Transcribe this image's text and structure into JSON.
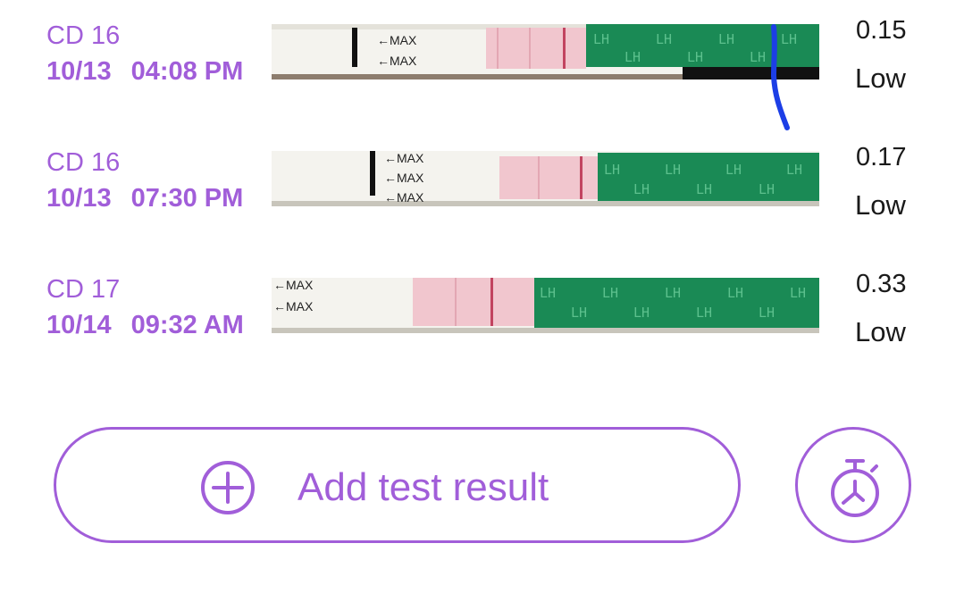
{
  "colors": {
    "accent": "#a15ed9",
    "text": "#1a1a1a",
    "strip_green": "#1a8a55",
    "strip_pink": "#f1c6ce"
  },
  "entries": [
    {
      "cycle_day": "CD 16",
      "date": "10/13",
      "time": "04:08 PM",
      "value": "0.15",
      "level": "Low"
    },
    {
      "cycle_day": "CD 16",
      "date": "10/13",
      "time": "07:30 PM",
      "value": "0.17",
      "level": "Low"
    },
    {
      "cycle_day": "CD 17",
      "date": "10/14",
      "time": "09:32 AM",
      "value": "0.33",
      "level": "Low"
    }
  ],
  "strip_text": {
    "max": "←MAX",
    "lh": "LH"
  },
  "add_button": {
    "label": "Add test result",
    "icon": "plus-circle-icon"
  },
  "timer_button": {
    "icon": "stopwatch-icon"
  }
}
